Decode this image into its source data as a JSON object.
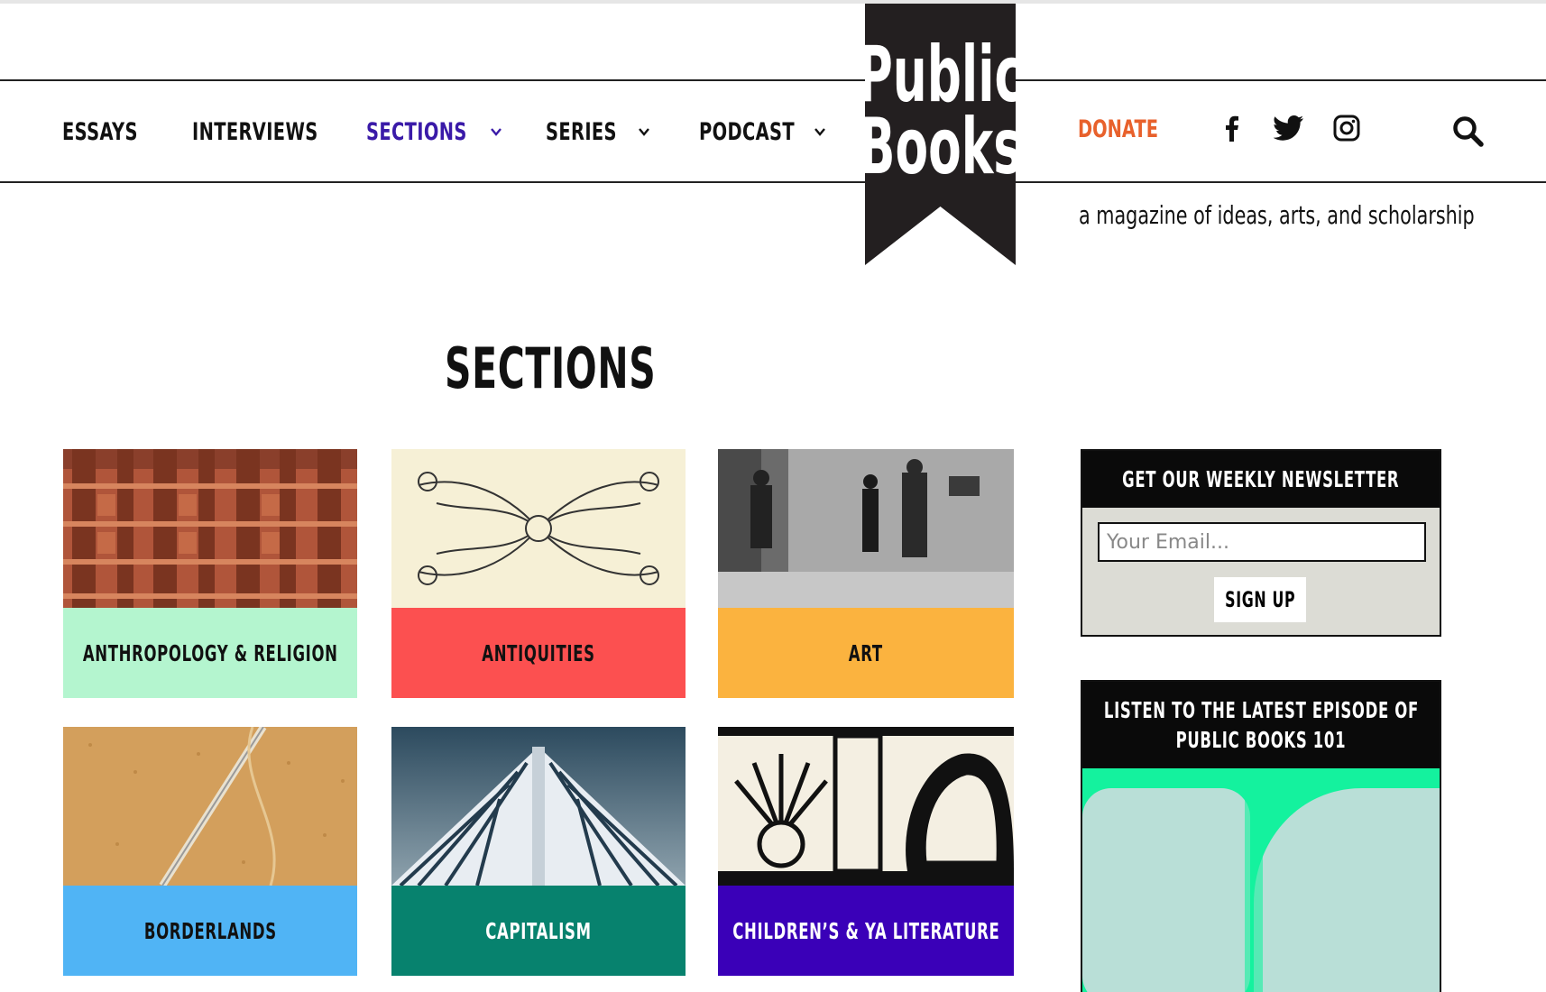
{
  "nav": {
    "items": [
      {
        "label": "ESSAYS"
      },
      {
        "label": "INTERVIEWS"
      },
      {
        "label": "SECTIONS"
      },
      {
        "label": "SERIES"
      },
      {
        "label": "PODCAST"
      }
    ],
    "donate": "DONATE"
  },
  "logo": {
    "line1": "Public",
    "line2": "Books"
  },
  "tagline": "a magazine of ideas, arts, and scholarship",
  "page_title": "SECTIONS",
  "sections": [
    {
      "label": "ANTHROPOLOGY & RELIGION",
      "color": "#b4f5cf"
    },
    {
      "label": "ANTIQUITIES",
      "color": "#fc5050"
    },
    {
      "label": "ART",
      "color": "#fbb33f"
    },
    {
      "label": "BORDERLANDS",
      "color": "#50b4f5"
    },
    {
      "label": "CAPITALISM",
      "color": "#07826e"
    },
    {
      "label": "CHILDREN’S & YA LITERATURE",
      "color": "#3a00b8"
    }
  ],
  "newsletter": {
    "title": "GET OUR WEEKLY NEWSLETTER",
    "email_placeholder": "Your Email...",
    "button": "SIGN UP"
  },
  "podcast": {
    "title_line1": "LISTEN TO THE LATEST EPISODE OF",
    "title_line2": "PUBLIC BOOKS 101"
  },
  "colors": {
    "accent": "#3a1aa8",
    "donate": "#e8612c"
  },
  "icons": [
    "facebook-icon",
    "twitter-icon",
    "instagram-icon",
    "search-icon",
    "chevron-down-icon"
  ]
}
